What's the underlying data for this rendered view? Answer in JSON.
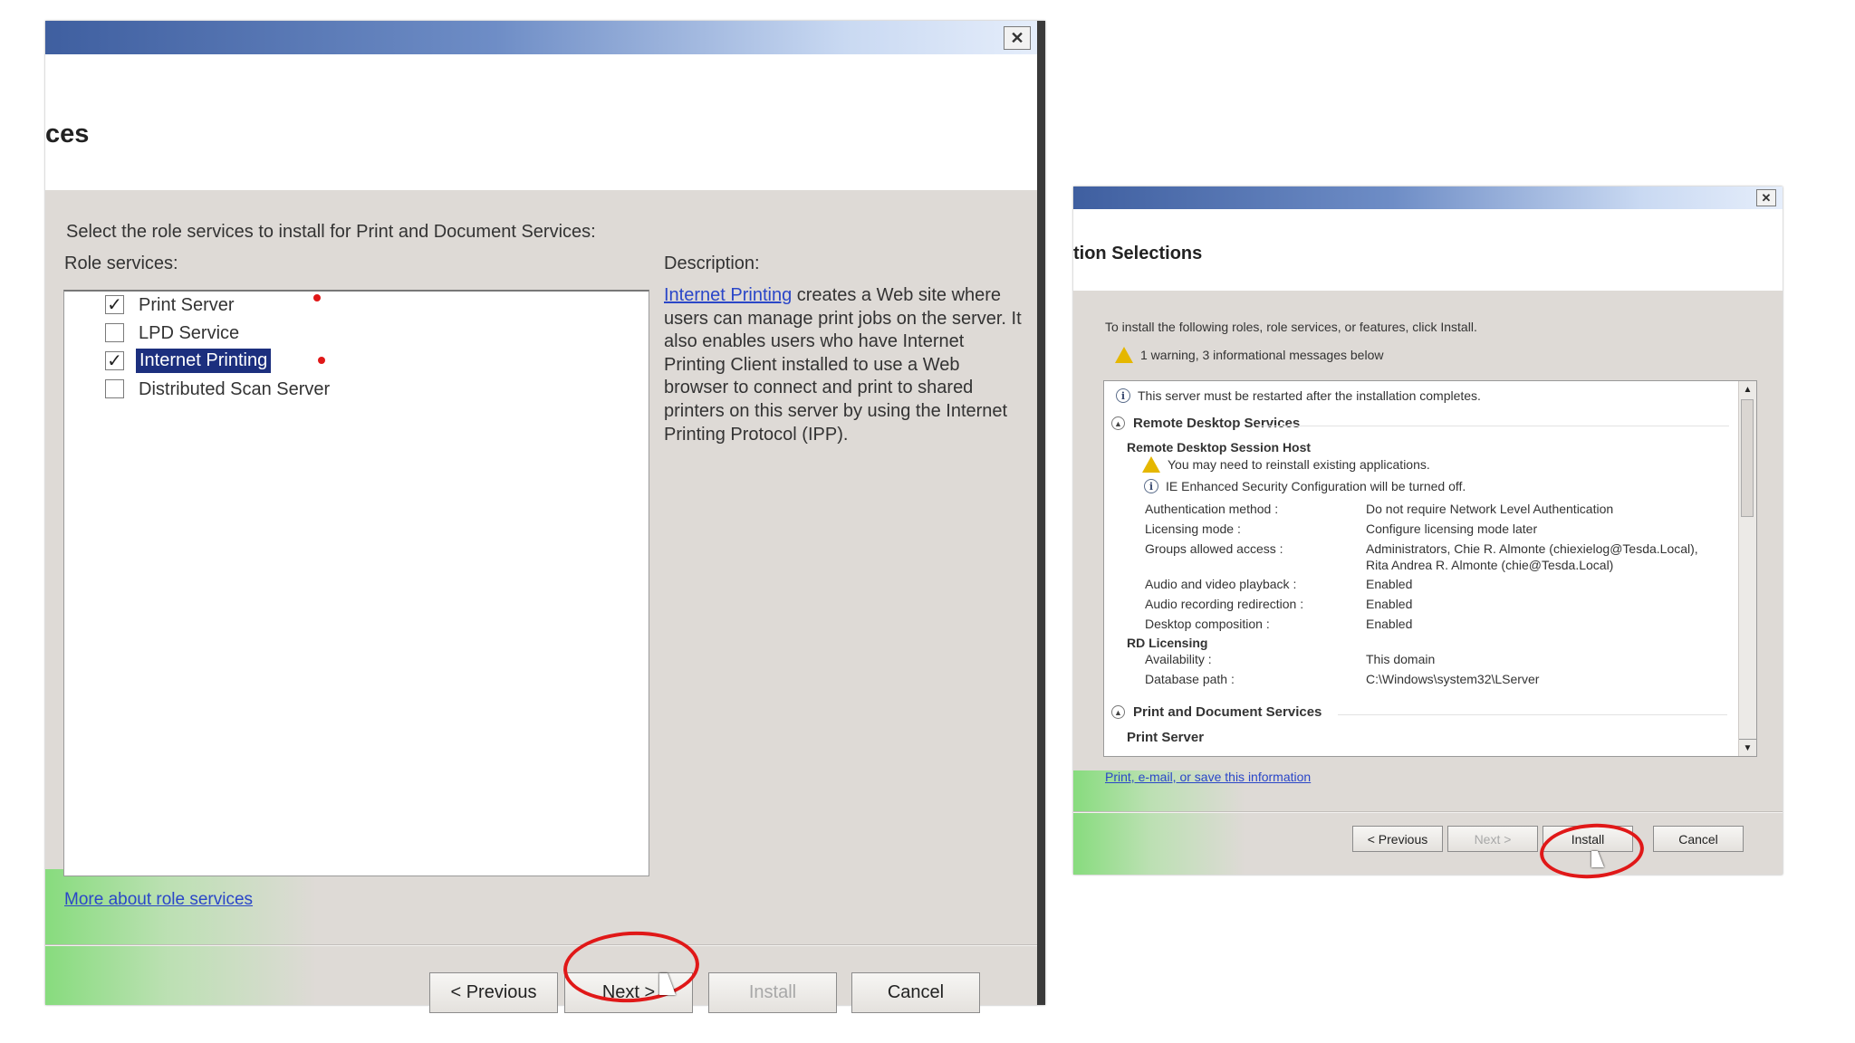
{
  "left_dialog": {
    "close_glyph": "✕",
    "title_fragment": "ces",
    "instruction": "Select the role services to install for Print and Document Services:",
    "role_services_label": "Role services:",
    "services": [
      {
        "label": "Print Server",
        "checked": true
      },
      {
        "label": "LPD Service",
        "checked": false
      },
      {
        "label": "Internet Printing",
        "checked": true
      },
      {
        "label": "Distributed Scan Server",
        "checked": false
      }
    ],
    "description_label": "Description:",
    "description_link": "Internet Printing",
    "description_text": " creates a Web site where users can manage print jobs on the server. It also enables users who have Internet Printing Client installed to use a Web browser to connect and print to shared printers on this server by using the Internet Printing Protocol (IPP).",
    "more_link": "More about role services",
    "buttons": {
      "previous": "< Previous",
      "next": "Next >",
      "install": "Install",
      "cancel": "Cancel"
    }
  },
  "right_dialog": {
    "close_glyph": "✕",
    "title_fragment": "tion Selections",
    "instruction": "To install the following roles, role services, or features, click Install.",
    "warning_summary": "1 warning, 3 informational messages below",
    "restart_msg": "This server must be restarted after the installation completes.",
    "section_rds": "Remote Desktop Services",
    "rdsh_title": "Remote Desktop Session Host",
    "reinstall_warning": "You may need to reinstall existing applications.",
    "ie_msg": "IE Enhanced Security Configuration will be turned off.",
    "rdsh_rows": [
      {
        "label": "Authentication method :",
        "value": "Do not require Network Level Authentication"
      },
      {
        "label": "Licensing mode :",
        "value": "Configure licensing mode later"
      },
      {
        "label": "Groups allowed access :",
        "value": "Administrators, Chie R. Almonte (chiexielog@Tesda.Local),",
        "value2": "Rita Andrea R. Almonte (chie@Tesda.Local)"
      },
      {
        "label": "Audio and video playback :",
        "value": "Enabled"
      },
      {
        "label": "Audio recording redirection :",
        "value": "Enabled"
      },
      {
        "label": "Desktop composition :",
        "value": "Enabled"
      }
    ],
    "rdl_title": "RD Licensing",
    "rdl_rows": [
      {
        "label": "Availability :",
        "value": "This domain"
      },
      {
        "label": "Database path :",
        "value": "C:\\Windows\\system32\\LServer"
      }
    ],
    "section_pds": "Print and Document Services",
    "print_server": "Print Server",
    "print_link": "Print, e-mail, or save this information",
    "buttons": {
      "previous": "< Previous",
      "next": "Next >",
      "install": "Install",
      "cancel": "Cancel"
    }
  },
  "colors": {
    "title_gradient_start": "#3f5fa0",
    "content_bg": "#dedad6",
    "highlight": "#1c2f7e",
    "annotation_red": "#e01818",
    "link": "#2a46c8"
  }
}
